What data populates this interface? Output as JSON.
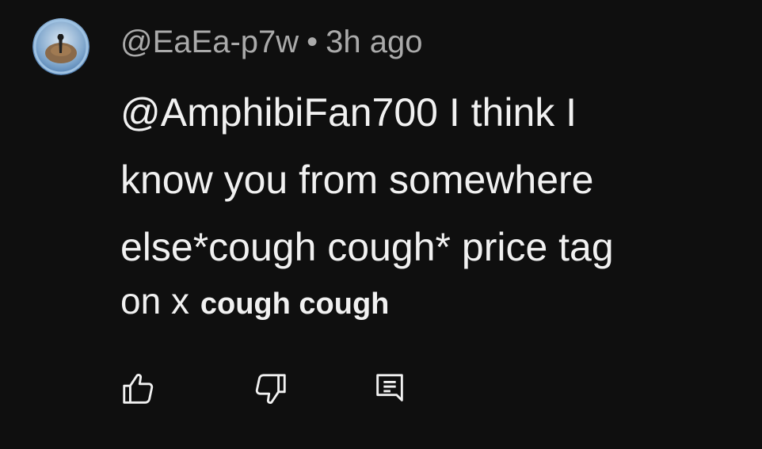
{
  "comment": {
    "author_handle": "@EaEa-p7w",
    "separator": "•",
    "timestamp": "3h ago",
    "text_lines": [
      "@AmphibiFan700 I think I",
      "know you from somewhere",
      "else*cough cough* price tag"
    ],
    "last_line_part1": "on x",
    "last_line_part2": "cough cough"
  },
  "actions": {
    "like_icon": "thumbs-up-icon",
    "dislike_icon": "thumbs-down-icon",
    "reply_icon": "reply-comment-icon"
  },
  "colors": {
    "background": "#0f0f0f",
    "text_primary": "#f1f1f1",
    "text_secondary": "#aaaaaa"
  }
}
